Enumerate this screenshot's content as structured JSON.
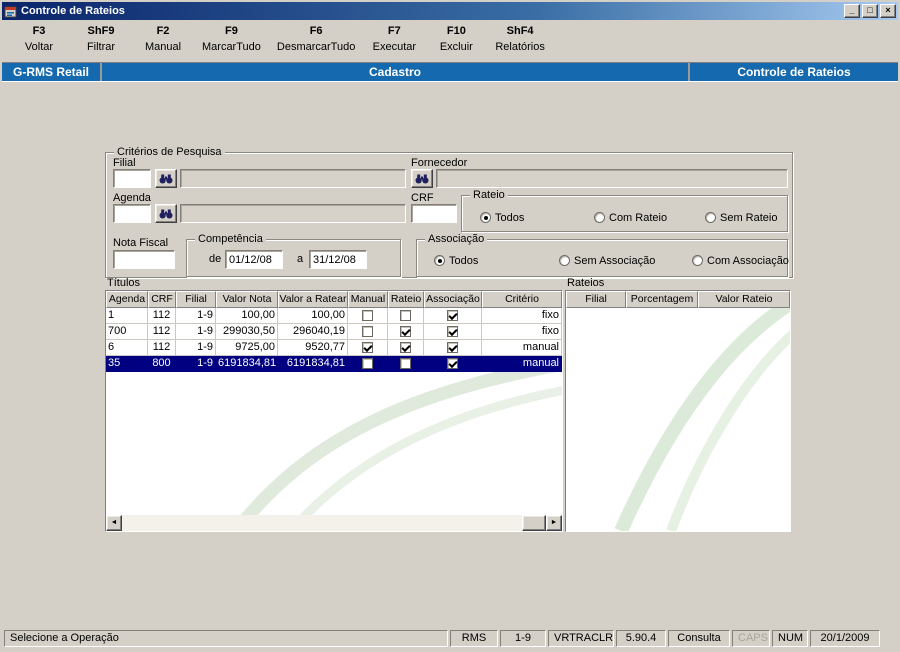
{
  "window": {
    "title": "Controle de Rateios"
  },
  "titlebar_buttons": {
    "minimize": "_",
    "restore": "□",
    "close": "×"
  },
  "toolbar": {
    "buttons": [
      {
        "key": "F3",
        "label": "Voltar"
      },
      {
        "key": "ShF9",
        "label": "Filtrar"
      },
      {
        "key": "F2",
        "label": "Manual"
      },
      {
        "key": "F9",
        "label": "MarcarTudo"
      },
      {
        "key": "F6",
        "label": "DesmarcarTudo"
      },
      {
        "key": "F7",
        "label": "Executar"
      },
      {
        "key": "F10",
        "label": "Excluir"
      },
      {
        "key": "ShF4",
        "label": "Relatórios"
      }
    ]
  },
  "header": {
    "left": "G-RMS Retail",
    "center": "Cadastro",
    "right": "Controle de Rateios"
  },
  "criteria": {
    "title": "Critérios de Pesquisa",
    "filial": {
      "label": "Filial",
      "value": "",
      "desc": ""
    },
    "fornecedor": {
      "label": "Fornecedor",
      "desc": ""
    },
    "agenda": {
      "label": "Agenda",
      "value": "",
      "desc": ""
    },
    "crf": {
      "label": "CRF",
      "value": ""
    },
    "nota_fiscal": {
      "label": "Nota Fiscal",
      "value": ""
    },
    "rateio": {
      "title": "Rateio",
      "options": [
        "Todos",
        "Com Rateio",
        "Sem Rateio"
      ],
      "selected": "Todos"
    },
    "competencia": {
      "title": "Competência",
      "de_label": "de",
      "de_value": "01/12/08",
      "a_label": "a",
      "a_value": "31/12/08"
    },
    "associacao": {
      "title": "Associação",
      "options": [
        "Todos",
        "Sem Associação",
        "Com Associação"
      ],
      "selected": "Todos"
    }
  },
  "titulos": {
    "title": "Títulos",
    "columns": [
      "Agenda",
      "CRF",
      "Filial",
      "Valor Nota",
      "Valor a Ratear",
      "Manual",
      "Rateio",
      "Associação",
      "Critério"
    ],
    "rows": [
      {
        "agenda": "1",
        "crf": "112",
        "filial": "1-9",
        "valor_nota": "100,00",
        "valor_ratear": "100,00",
        "manual": false,
        "rateio": false,
        "associacao": true,
        "criterio": "fixo",
        "selected": false
      },
      {
        "agenda": "700",
        "crf": "112",
        "filial": "1-9",
        "valor_nota": "299030,50",
        "valor_ratear": "296040,19",
        "manual": false,
        "rateio": true,
        "associacao": true,
        "criterio": "fixo",
        "selected": false
      },
      {
        "agenda": "6",
        "crf": "112",
        "filial": "1-9",
        "valor_nota": "9725,00",
        "valor_ratear": "9520,77",
        "manual": true,
        "rateio": true,
        "associacao": true,
        "criterio": "manual",
        "selected": false
      },
      {
        "agenda": "35",
        "crf": "800",
        "filial": "1-9",
        "valor_nota": "6191834,81",
        "valor_ratear": "6191834,81",
        "manual": false,
        "rateio": false,
        "associacao": true,
        "criterio": "manual",
        "selected": true
      }
    ]
  },
  "rateios": {
    "title": "Rateios",
    "columns": [
      "Filial",
      "Porcentagem",
      "Valor Rateio"
    ],
    "rows": []
  },
  "statusbar": {
    "message": "Selecione a Operação",
    "cells": [
      "RMS",
      "1-9",
      "VRTRACLR",
      "5.90.4",
      "Consulta",
      "CAPS",
      "NUM",
      "20/1/2009"
    ],
    "disabled": [
      "CAPS"
    ]
  },
  "colors": {
    "accent": "#1569ae",
    "selection": "#000080",
    "window": "#d4d0c8",
    "watermark": "#dfeadd"
  }
}
